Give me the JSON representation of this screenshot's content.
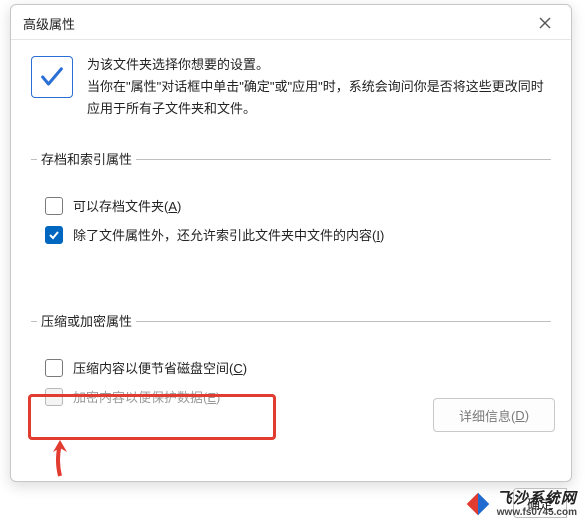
{
  "dialog": {
    "title": "高级属性",
    "intro_line1": "为该文件夹选择你想要的设置。",
    "intro_line2": "当你在\"属性\"对话框中单击\"确定\"或\"应用\"时，系统会询问你是否将这些更改同时应用于所有子文件夹和文件。"
  },
  "group_archive": {
    "legend": "存档和索引属性",
    "archive_label_pre": "可以存档文件夹(",
    "archive_hot": "A",
    "archive_label_post": ")",
    "archive_checked": false,
    "index_label_pre": "除了文件属性外，还允许索引此文件夹中文件的内容(",
    "index_hot": "I",
    "index_label_post": ")",
    "index_checked": true
  },
  "group_compress": {
    "legend": "压缩或加密属性",
    "compress_label_pre": "压缩内容以便节省磁盘空间(",
    "compress_hot": "C",
    "compress_label_post": ")",
    "compress_checked": false,
    "encrypt_label_pre": "加密内容以便保护数据(",
    "encrypt_hot": "E",
    "encrypt_label_post": ")",
    "encrypt_checked": false,
    "encrypt_enabled": false
  },
  "buttons": {
    "details_pre": "详细信息(",
    "details_hot": "D",
    "details_post": ")",
    "ok": "确定"
  },
  "watermark": {
    "name": "飞沙系统网",
    "url": "www.fs0745.com"
  }
}
